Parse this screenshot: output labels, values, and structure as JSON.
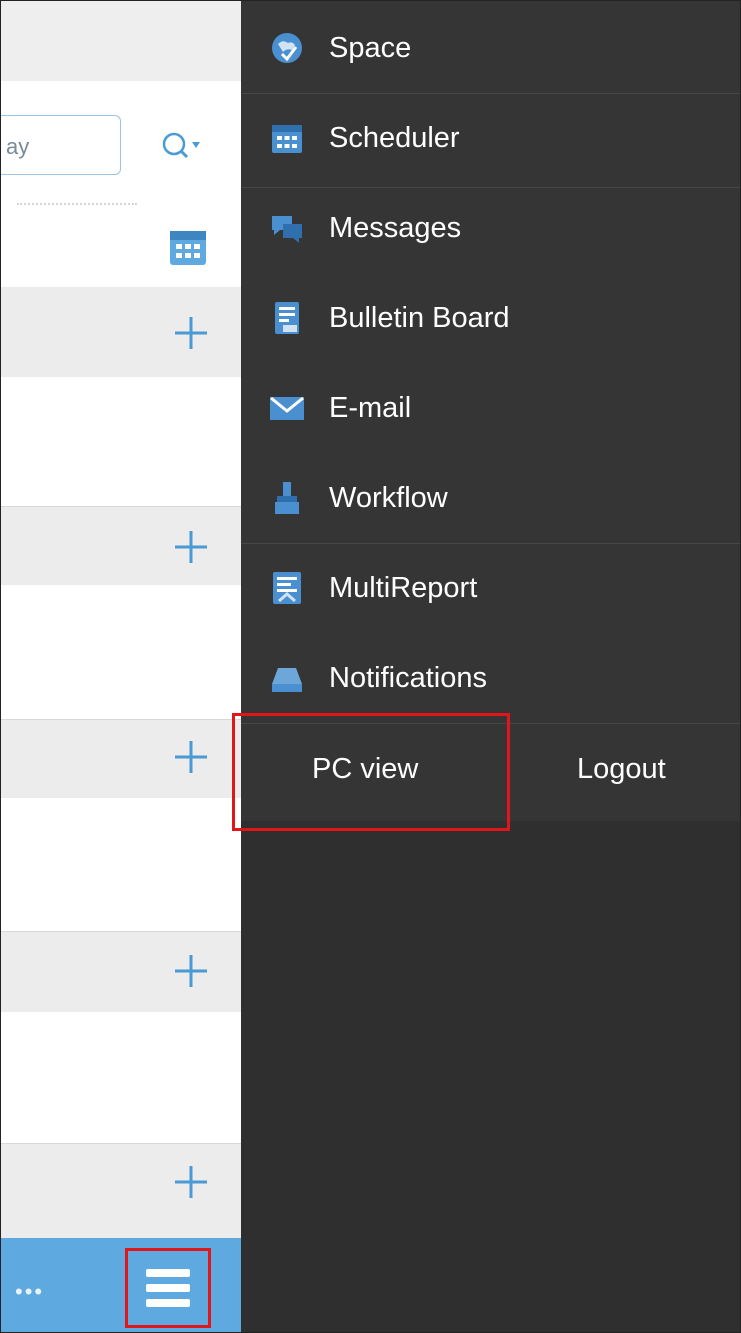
{
  "search": {
    "placeholder_fragment": "ay"
  },
  "menu": {
    "items": [
      {
        "label": "Space",
        "icon": "space-icon"
      },
      {
        "label": "Scheduler",
        "icon": "calendar-icon"
      },
      {
        "label": "Messages",
        "icon": "messages-icon"
      },
      {
        "label": "Bulletin Board",
        "icon": "bulletin-board-icon"
      },
      {
        "label": "E-mail",
        "icon": "email-icon"
      },
      {
        "label": "Workflow",
        "icon": "workflow-icon"
      },
      {
        "label": "MultiReport",
        "icon": "multireport-icon"
      },
      {
        "label": "Notifications",
        "icon": "notifications-icon"
      }
    ],
    "footer": {
      "pc_view": "PC view",
      "logout": "Logout"
    }
  },
  "bottom_bar": {
    "more": "•••"
  },
  "colors": {
    "accent": "#5ea9e0",
    "highlight": "#e0161b",
    "menu_bg": "#353535"
  }
}
